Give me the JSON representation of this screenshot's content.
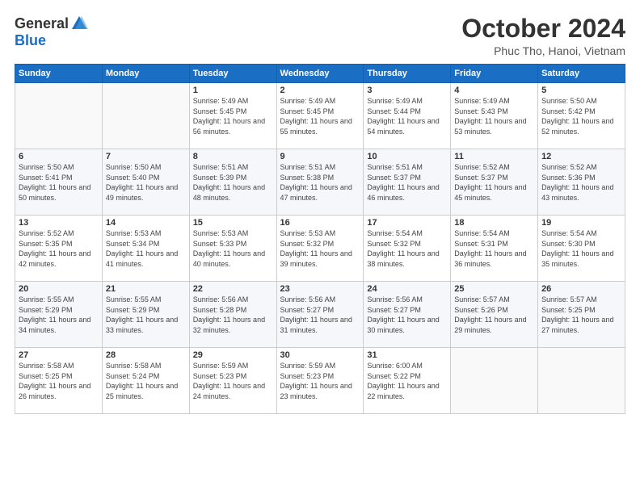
{
  "header": {
    "logo_general": "General",
    "logo_blue": "Blue",
    "month_title": "October 2024",
    "subtitle": "Phuc Tho, Hanoi, Vietnam"
  },
  "weekdays": [
    "Sunday",
    "Monday",
    "Tuesday",
    "Wednesday",
    "Thursday",
    "Friday",
    "Saturday"
  ],
  "weeks": [
    [
      {
        "day": "",
        "detail": ""
      },
      {
        "day": "",
        "detail": ""
      },
      {
        "day": "1",
        "detail": "Sunrise: 5:49 AM\nSunset: 5:45 PM\nDaylight: 11 hours and 56 minutes."
      },
      {
        "day": "2",
        "detail": "Sunrise: 5:49 AM\nSunset: 5:45 PM\nDaylight: 11 hours and 55 minutes."
      },
      {
        "day": "3",
        "detail": "Sunrise: 5:49 AM\nSunset: 5:44 PM\nDaylight: 11 hours and 54 minutes."
      },
      {
        "day": "4",
        "detail": "Sunrise: 5:49 AM\nSunset: 5:43 PM\nDaylight: 11 hours and 53 minutes."
      },
      {
        "day": "5",
        "detail": "Sunrise: 5:50 AM\nSunset: 5:42 PM\nDaylight: 11 hours and 52 minutes."
      }
    ],
    [
      {
        "day": "6",
        "detail": "Sunrise: 5:50 AM\nSunset: 5:41 PM\nDaylight: 11 hours and 50 minutes."
      },
      {
        "day": "7",
        "detail": "Sunrise: 5:50 AM\nSunset: 5:40 PM\nDaylight: 11 hours and 49 minutes."
      },
      {
        "day": "8",
        "detail": "Sunrise: 5:51 AM\nSunset: 5:39 PM\nDaylight: 11 hours and 48 minutes."
      },
      {
        "day": "9",
        "detail": "Sunrise: 5:51 AM\nSunset: 5:38 PM\nDaylight: 11 hours and 47 minutes."
      },
      {
        "day": "10",
        "detail": "Sunrise: 5:51 AM\nSunset: 5:37 PM\nDaylight: 11 hours and 46 minutes."
      },
      {
        "day": "11",
        "detail": "Sunrise: 5:52 AM\nSunset: 5:37 PM\nDaylight: 11 hours and 45 minutes."
      },
      {
        "day": "12",
        "detail": "Sunrise: 5:52 AM\nSunset: 5:36 PM\nDaylight: 11 hours and 43 minutes."
      }
    ],
    [
      {
        "day": "13",
        "detail": "Sunrise: 5:52 AM\nSunset: 5:35 PM\nDaylight: 11 hours and 42 minutes."
      },
      {
        "day": "14",
        "detail": "Sunrise: 5:53 AM\nSunset: 5:34 PM\nDaylight: 11 hours and 41 minutes."
      },
      {
        "day": "15",
        "detail": "Sunrise: 5:53 AM\nSunset: 5:33 PM\nDaylight: 11 hours and 40 minutes."
      },
      {
        "day": "16",
        "detail": "Sunrise: 5:53 AM\nSunset: 5:32 PM\nDaylight: 11 hours and 39 minutes."
      },
      {
        "day": "17",
        "detail": "Sunrise: 5:54 AM\nSunset: 5:32 PM\nDaylight: 11 hours and 38 minutes."
      },
      {
        "day": "18",
        "detail": "Sunrise: 5:54 AM\nSunset: 5:31 PM\nDaylight: 11 hours and 36 minutes."
      },
      {
        "day": "19",
        "detail": "Sunrise: 5:54 AM\nSunset: 5:30 PM\nDaylight: 11 hours and 35 minutes."
      }
    ],
    [
      {
        "day": "20",
        "detail": "Sunrise: 5:55 AM\nSunset: 5:29 PM\nDaylight: 11 hours and 34 minutes."
      },
      {
        "day": "21",
        "detail": "Sunrise: 5:55 AM\nSunset: 5:29 PM\nDaylight: 11 hours and 33 minutes."
      },
      {
        "day": "22",
        "detail": "Sunrise: 5:56 AM\nSunset: 5:28 PM\nDaylight: 11 hours and 32 minutes."
      },
      {
        "day": "23",
        "detail": "Sunrise: 5:56 AM\nSunset: 5:27 PM\nDaylight: 11 hours and 31 minutes."
      },
      {
        "day": "24",
        "detail": "Sunrise: 5:56 AM\nSunset: 5:27 PM\nDaylight: 11 hours and 30 minutes."
      },
      {
        "day": "25",
        "detail": "Sunrise: 5:57 AM\nSunset: 5:26 PM\nDaylight: 11 hours and 29 minutes."
      },
      {
        "day": "26",
        "detail": "Sunrise: 5:57 AM\nSunset: 5:25 PM\nDaylight: 11 hours and 27 minutes."
      }
    ],
    [
      {
        "day": "27",
        "detail": "Sunrise: 5:58 AM\nSunset: 5:25 PM\nDaylight: 11 hours and 26 minutes."
      },
      {
        "day": "28",
        "detail": "Sunrise: 5:58 AM\nSunset: 5:24 PM\nDaylight: 11 hours and 25 minutes."
      },
      {
        "day": "29",
        "detail": "Sunrise: 5:59 AM\nSunset: 5:23 PM\nDaylight: 11 hours and 24 minutes."
      },
      {
        "day": "30",
        "detail": "Sunrise: 5:59 AM\nSunset: 5:23 PM\nDaylight: 11 hours and 23 minutes."
      },
      {
        "day": "31",
        "detail": "Sunrise: 6:00 AM\nSunset: 5:22 PM\nDaylight: 11 hours and 22 minutes."
      },
      {
        "day": "",
        "detail": ""
      },
      {
        "day": "",
        "detail": ""
      }
    ]
  ]
}
